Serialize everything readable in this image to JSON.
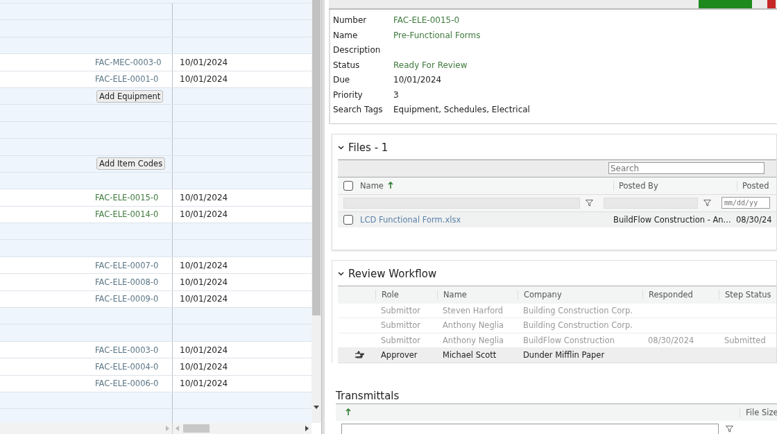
{
  "grid": {
    "rows": [
      {
        "kind": "blank"
      },
      {
        "kind": "blank"
      },
      {
        "kind": "blank"
      },
      {
        "kind": "item",
        "number": "FAC-MEC-0003-0",
        "color": "#5b7686",
        "date": "10/01/2024"
      },
      {
        "kind": "item",
        "number": "FAC-ELE-0001-0",
        "color": "#5b7686",
        "date": "10/01/2024"
      },
      {
        "kind": "button",
        "label": "Add Equipment"
      },
      {
        "kind": "blank"
      },
      {
        "kind": "blank"
      },
      {
        "kind": "blank"
      },
      {
        "kind": "button",
        "label": "Add Item Codes"
      },
      {
        "kind": "blank"
      },
      {
        "kind": "item",
        "number": "FAC-ELE-0015-0",
        "color": "#3e7a3e",
        "date": "10/01/2024"
      },
      {
        "kind": "item",
        "number": "FAC-ELE-0014-0",
        "color": "#3e7a3e",
        "date": "10/01/2024"
      },
      {
        "kind": "blank"
      },
      {
        "kind": "blank"
      },
      {
        "kind": "item",
        "number": "FAC-ELE-0007-0",
        "color": "#5b7686",
        "date": "10/01/2024"
      },
      {
        "kind": "item",
        "number": "FAC-ELE-0008-0",
        "color": "#5b7686",
        "date": "10/01/2024"
      },
      {
        "kind": "item",
        "number": "FAC-ELE-0009-0",
        "color": "#5b7686",
        "date": "10/01/2024"
      },
      {
        "kind": "blank"
      },
      {
        "kind": "blank"
      },
      {
        "kind": "item",
        "number": "FAC-ELE-0003-0",
        "color": "#5b7686",
        "date": "10/01/2024"
      },
      {
        "kind": "item",
        "number": "FAC-ELE-0004-0",
        "color": "#5b7686",
        "date": "10/01/2024"
      },
      {
        "kind": "item",
        "number": "FAC-ELE-0006-0",
        "color": "#5b7686",
        "date": "10/01/2024"
      },
      {
        "kind": "blank"
      },
      {
        "kind": "blank"
      }
    ]
  },
  "details": [
    {
      "label": "Number",
      "value": "FAC-ELE-0015-0",
      "kind": "link"
    },
    {
      "label": "Name",
      "value": "Pre-Functional Forms",
      "kind": "link"
    },
    {
      "label": "Description"
    },
    {
      "label": "Status",
      "value": "Ready For Review",
      "kind": "link"
    },
    {
      "label": "Due",
      "value": "10/01/2024",
      "kind": "text"
    },
    {
      "label": "Priority",
      "value": "3",
      "kind": "text"
    },
    {
      "label": "Search Tags",
      "value": "Equipment, Schedules, Electrical",
      "kind": "text"
    }
  ],
  "files": {
    "title": "Files - 1",
    "search": {
      "placeholder": "Search"
    },
    "all_checked": false,
    "columns": [
      "Name",
      "Posted By",
      "Posted"
    ],
    "date_placeholder": "mm/dd/yy",
    "rows": [
      {
        "name": "LCD Functional Form.xlsx",
        "posted_by": "BuildFlow Construction - An...",
        "posted": "08/30/24",
        "checked": false
      }
    ]
  },
  "workflow": {
    "title": "Review Workflow",
    "columns": [
      "Role",
      "Name",
      "Company",
      "Responded",
      "Step Status"
    ],
    "rows": [
      {
        "role": "Submittor",
        "name": "Steven Harford",
        "company": "Building Construction Corp.",
        "current": false
      },
      {
        "role": "Submittor",
        "name": "Anthony Neglia",
        "company": "Building Construction Corp.",
        "current": false
      },
      {
        "role": "Submittor",
        "name": "Anthony Neglia",
        "company": "BuildFlow Construction",
        "responded": "08/30/2024",
        "step_status": "Submitted",
        "current": false
      },
      {
        "role": "Approver",
        "name": "Michael Scott",
        "company": "Dunder Mifflin Paper",
        "current": true
      }
    ]
  },
  "transmittals": {
    "title": "Transmittals",
    "columns": [
      "File Size"
    ]
  }
}
